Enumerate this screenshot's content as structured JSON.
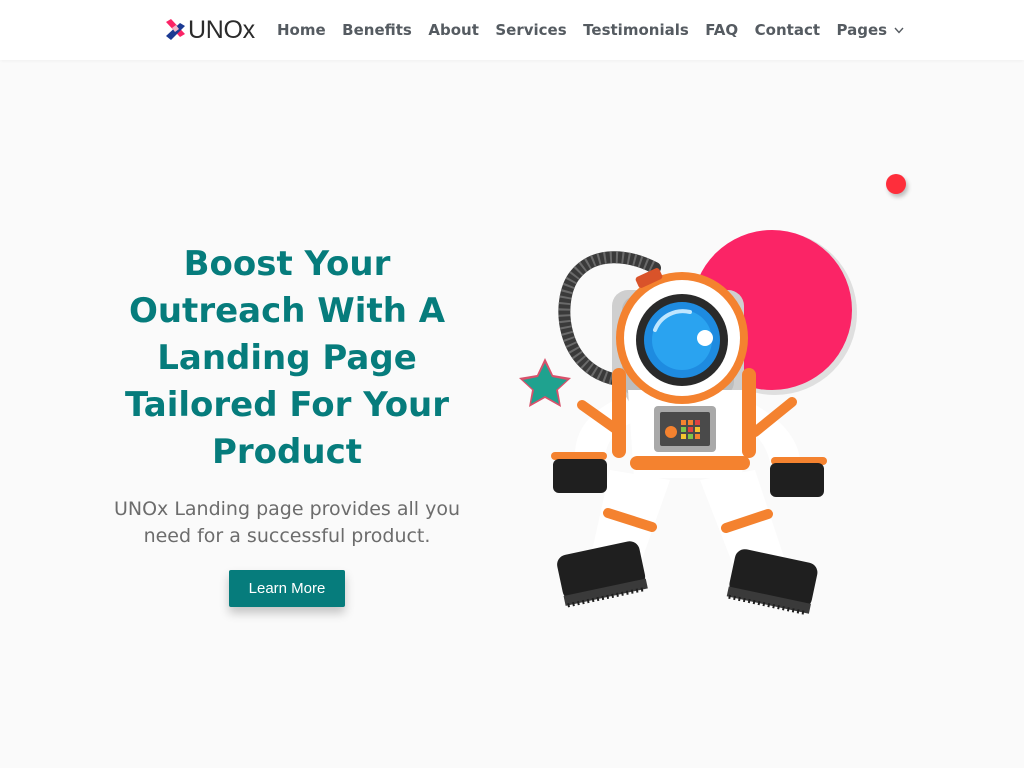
{
  "brand": {
    "name": "UNOx",
    "logo_icon": "unox-x-logo-icon"
  },
  "nav": {
    "items": [
      {
        "label": "Home"
      },
      {
        "label": "Benefits"
      },
      {
        "label": "About"
      },
      {
        "label": "Services"
      },
      {
        "label": "Testimonials"
      },
      {
        "label": "FAQ"
      },
      {
        "label": "Contact"
      },
      {
        "label": "Pages",
        "icon": "chevron-down-icon"
      }
    ]
  },
  "hero": {
    "title": "Boost Your Outreach With A Landing Page Tailored For Your Product",
    "subtitle": "UNOx Landing page provides all you need for a successful product.",
    "cta_label": "Learn More",
    "illustration": "astronaut-illustration"
  },
  "colors": {
    "accent": "#067c7c",
    "title": "#067c7c",
    "nav_text": "#555b61",
    "body_text": "#6c6c6c",
    "background": "#fafafa",
    "red_dot": "#fe2e3b",
    "pink_circle": "#fb2466",
    "astronaut_orange": "#f4822f"
  }
}
